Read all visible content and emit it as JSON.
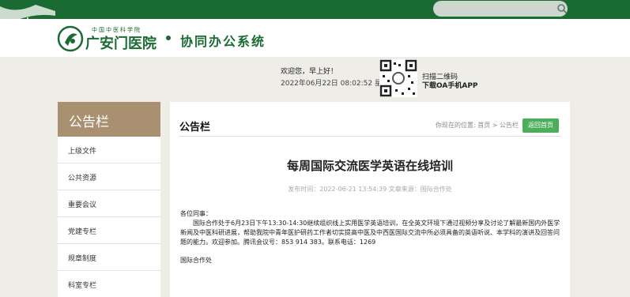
{
  "colors": {
    "brand_green": "#1a6b33",
    "sidebar_head": "#a89070",
    "button_green": "#4cae5b",
    "background": "#eeede8"
  },
  "topbar": {
    "search_icon": "search-icon"
  },
  "logo": {
    "subtitle": "中国中医科学院",
    "name": "广安门医院",
    "icon": "hospital-logo-icon"
  },
  "system_title": "协同办公系统",
  "welcome": {
    "greeting": "欢迎您，早上好！",
    "datetime": "2022年06月22日 08:02:52 星期三"
  },
  "qr": {
    "line1": "扫描二维码",
    "line2": "下载OA手机APP",
    "icon": "qr-code-icon"
  },
  "sidebar": {
    "title": "公告栏",
    "items": [
      {
        "label": "上级文件"
      },
      {
        "label": "公共资源"
      },
      {
        "label": "重要会议"
      },
      {
        "label": "党建专栏"
      },
      {
        "label": "规章制度"
      },
      {
        "label": "科室专栏"
      }
    ]
  },
  "content": {
    "title": "公告栏",
    "breadcrumb": {
      "prefix": "你现在的位置:",
      "home": "首页",
      "separator": ">",
      "current": "公告栏"
    },
    "back_button": "返回首页"
  },
  "article": {
    "title": "每周国际交流医学英语在线培训",
    "meta": "发布时间：2022-06-21 13:54:39 文章来源：国际合作处",
    "greeting": "各位同事：",
    "body": "　　国际合作处于6月23日下午13:30-14:30继续组织线上实用医学英语培训，在全英文环境下通过视频分享及讨论了解最新国内外医学新闻及中医科研进展，帮助我院中青年医护研药工作者切实提高中医及中西医国际交流中所必须具备的英语听说、本学科的演讲及回答问题的能力。欢迎参加。腾讯会议号：853 914 383。联系电话：1269",
    "signoff": "国际合作处"
  }
}
